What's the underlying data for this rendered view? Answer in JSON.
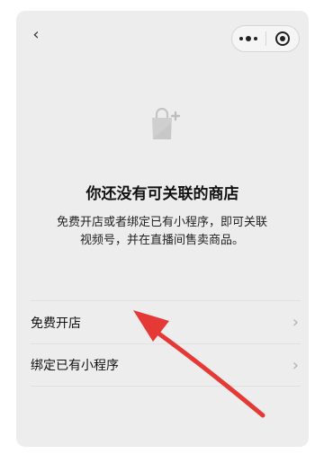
{
  "nav": {
    "back_glyph": "‹",
    "more_icon": "more-dots-icon",
    "close_icon": "mini-program-close-icon"
  },
  "empty_state": {
    "icon": "shopping-bag-add-icon",
    "title": "你还没有可关联的商店",
    "description": "免费开店或者绑定已有小程序，即可关联视频号，并在直播间售卖商品。"
  },
  "options": [
    {
      "label": "免费开店",
      "chevron": "›"
    },
    {
      "label": "绑定已有小程序",
      "chevron": "›"
    }
  ],
  "annotation": {
    "type": "red-arrow",
    "points_to": "免费开店",
    "color": "#e53935"
  },
  "colors": {
    "background": "#ededed",
    "text": "#111111",
    "divider": "#e0e0e0",
    "chevron": "#b0b0b0"
  }
}
